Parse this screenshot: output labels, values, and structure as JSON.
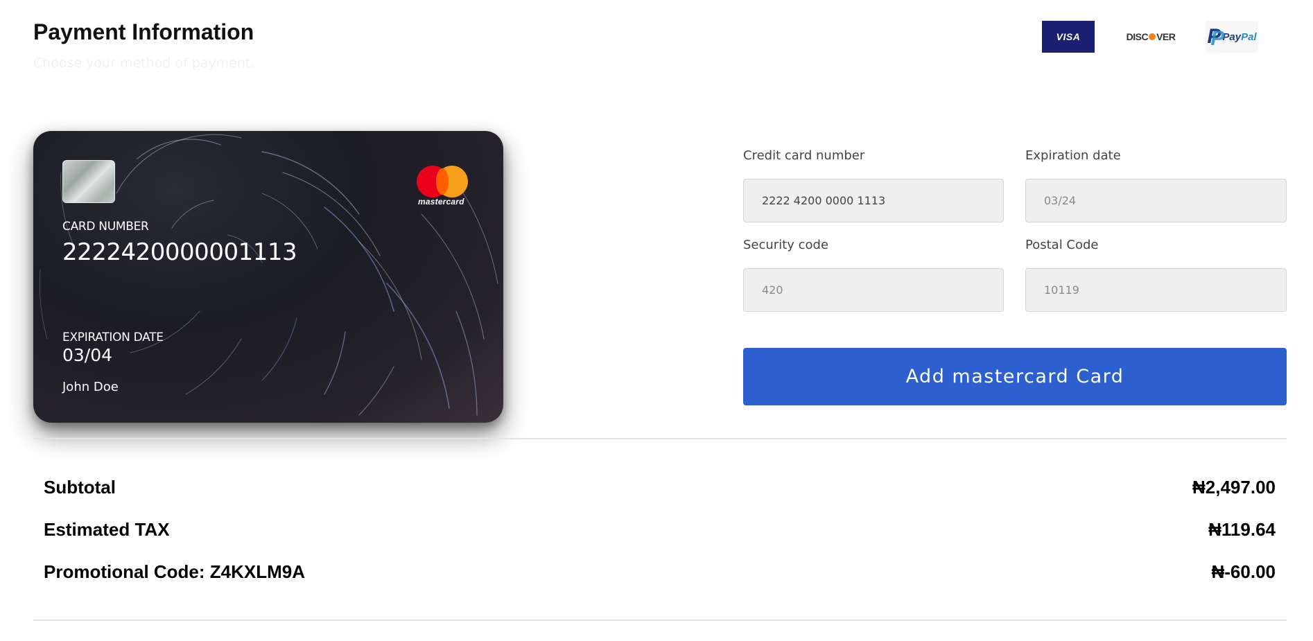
{
  "header": {
    "title": "Payment Information",
    "subtitle": "Choose your method of payment."
  },
  "payment_logos": [
    {
      "name": "Visa",
      "text": "VISA",
      "color": "#1a1f71"
    },
    {
      "name": "Discover",
      "text_before": "DISC",
      "text_after": "VER",
      "color": "#f58220"
    },
    {
      "name": "PayPal",
      "text_a": "Pay",
      "text_b": "Pal",
      "colors": [
        "#1f3a85",
        "#2790c3"
      ]
    }
  ],
  "card": {
    "brand": "mastercard",
    "number_label": "CARD NUMBER",
    "number": "2222420000001113",
    "expiration_label": "EXPIRATION DATE",
    "expiration": "03/04",
    "holder": "John Doe"
  },
  "form": {
    "card_number": {
      "label": "Credit card number",
      "value": "2222 4200 0000 1113",
      "placeholder": ""
    },
    "expiration": {
      "label": "Expiration date",
      "value": "",
      "placeholder": "03/24"
    },
    "security_code": {
      "label": "Security code",
      "value": "",
      "placeholder": "420"
    },
    "postal_code": {
      "label": "Postal Code",
      "value": "",
      "placeholder": "10119"
    },
    "submit_label": "Add mastercard Card",
    "accent_color": "#2d5fcf"
  },
  "summary": [
    {
      "label": "Subtotal",
      "value": "₦2,497.00"
    },
    {
      "label": "Estimated TAX",
      "value": "₦119.64"
    },
    {
      "label": "Promotional Code: Z4KXLM9A",
      "value": "₦-60.00"
    }
  ]
}
